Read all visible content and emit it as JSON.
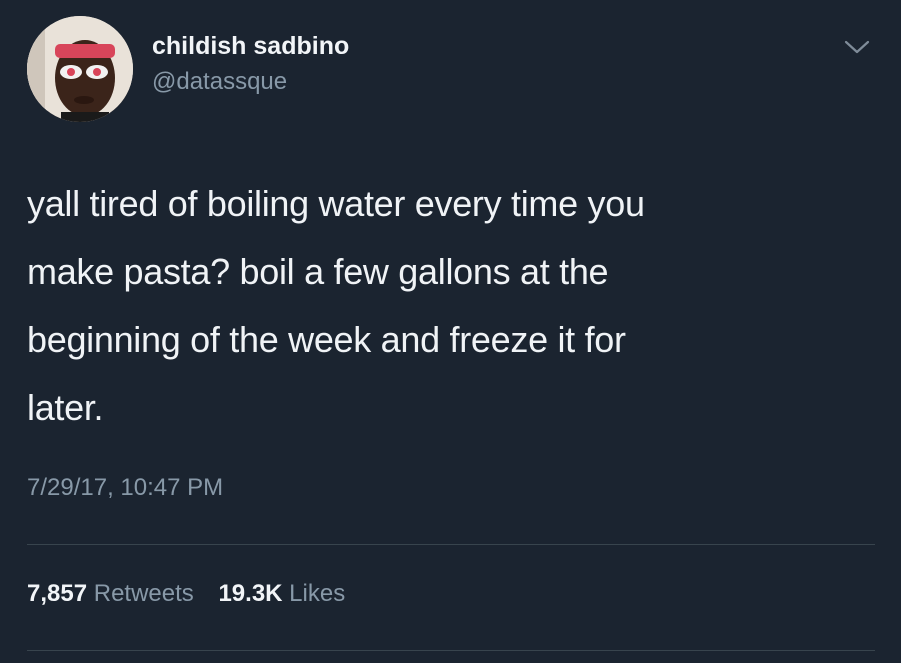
{
  "tweet": {
    "author": {
      "display_name": "childish sadbino",
      "handle": "@datassque"
    },
    "text_lines": [
      "yall tired of boiling water every time you",
      "make pasta? boil a few gallons at the",
      "beginning of the week and freeze it for",
      "later."
    ],
    "timestamp": "7/29/17, 10:47 PM",
    "stats": {
      "retweets_count": "7,857",
      "retweets_label": "Retweets",
      "likes_count": "19.3K",
      "likes_label": "Likes"
    },
    "icons": {
      "menu": "chevron-down-icon",
      "avatar": "profile-photo"
    },
    "colors": {
      "background": "#1b2430",
      "primary_text": "#f0f3f6",
      "secondary_text": "#8899a8",
      "divider": "#38444d"
    }
  }
}
